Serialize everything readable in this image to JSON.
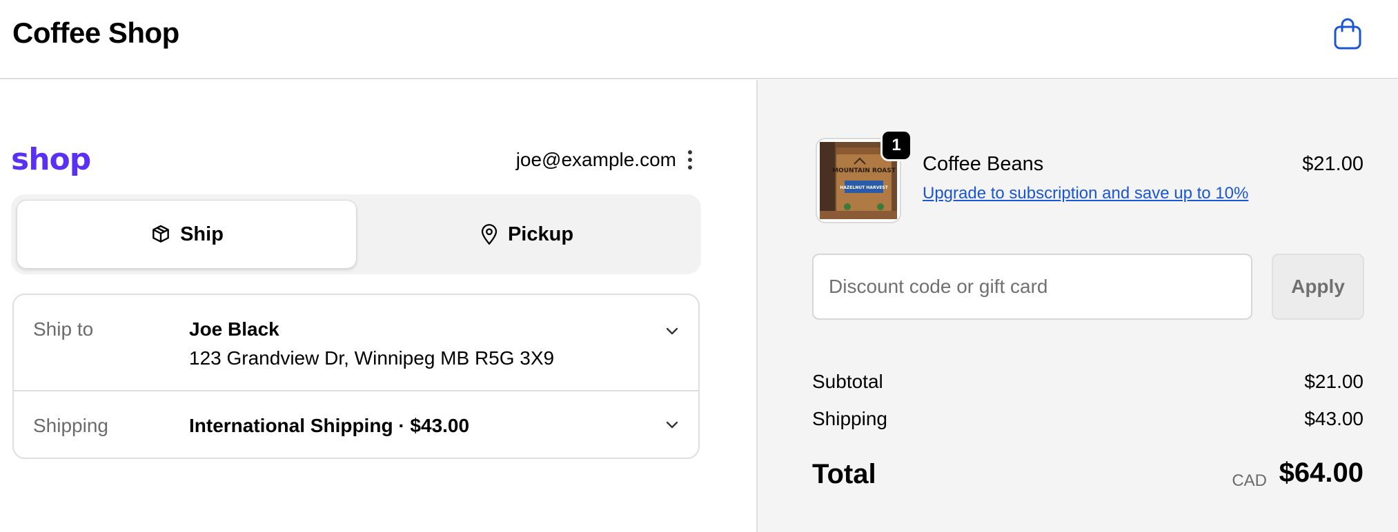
{
  "header": {
    "store_name": "Coffee Shop",
    "cart_icon": "shopping-bag-icon",
    "accent_color": "#1a55d6"
  },
  "account": {
    "logo_text": "shop",
    "logo_color": "#5a31f4",
    "email": "joe@example.com"
  },
  "delivery": {
    "tabs": [
      {
        "label": "Ship",
        "icon": "box-icon",
        "selected": true
      },
      {
        "label": "Pickup",
        "icon": "map-pin-icon",
        "selected": false
      }
    ]
  },
  "review": {
    "ship_to": {
      "label": "Ship to",
      "name": "Joe Black",
      "address": "123 Grandview Dr, Winnipeg MB R5G 3X9"
    },
    "shipping": {
      "label": "Shipping",
      "method": "International Shipping · $43.00"
    }
  },
  "order": {
    "item": {
      "title": "Coffee Beans",
      "price": "$21.00",
      "quantity": "1",
      "upsell": "Upgrade to subscription and save up to 10%",
      "image_label": "MOUNTAIN ROAST",
      "image_sublabel": "HAZELNUT HARVEST"
    },
    "discount": {
      "placeholder": "Discount code or gift card",
      "value": "",
      "apply_label": "Apply"
    },
    "summary": {
      "subtotal_label": "Subtotal",
      "subtotal_value": "$21.00",
      "shipping_label": "Shipping",
      "shipping_value": "$43.00",
      "total_label": "Total",
      "currency": "CAD",
      "total_value": "$64.00"
    }
  }
}
